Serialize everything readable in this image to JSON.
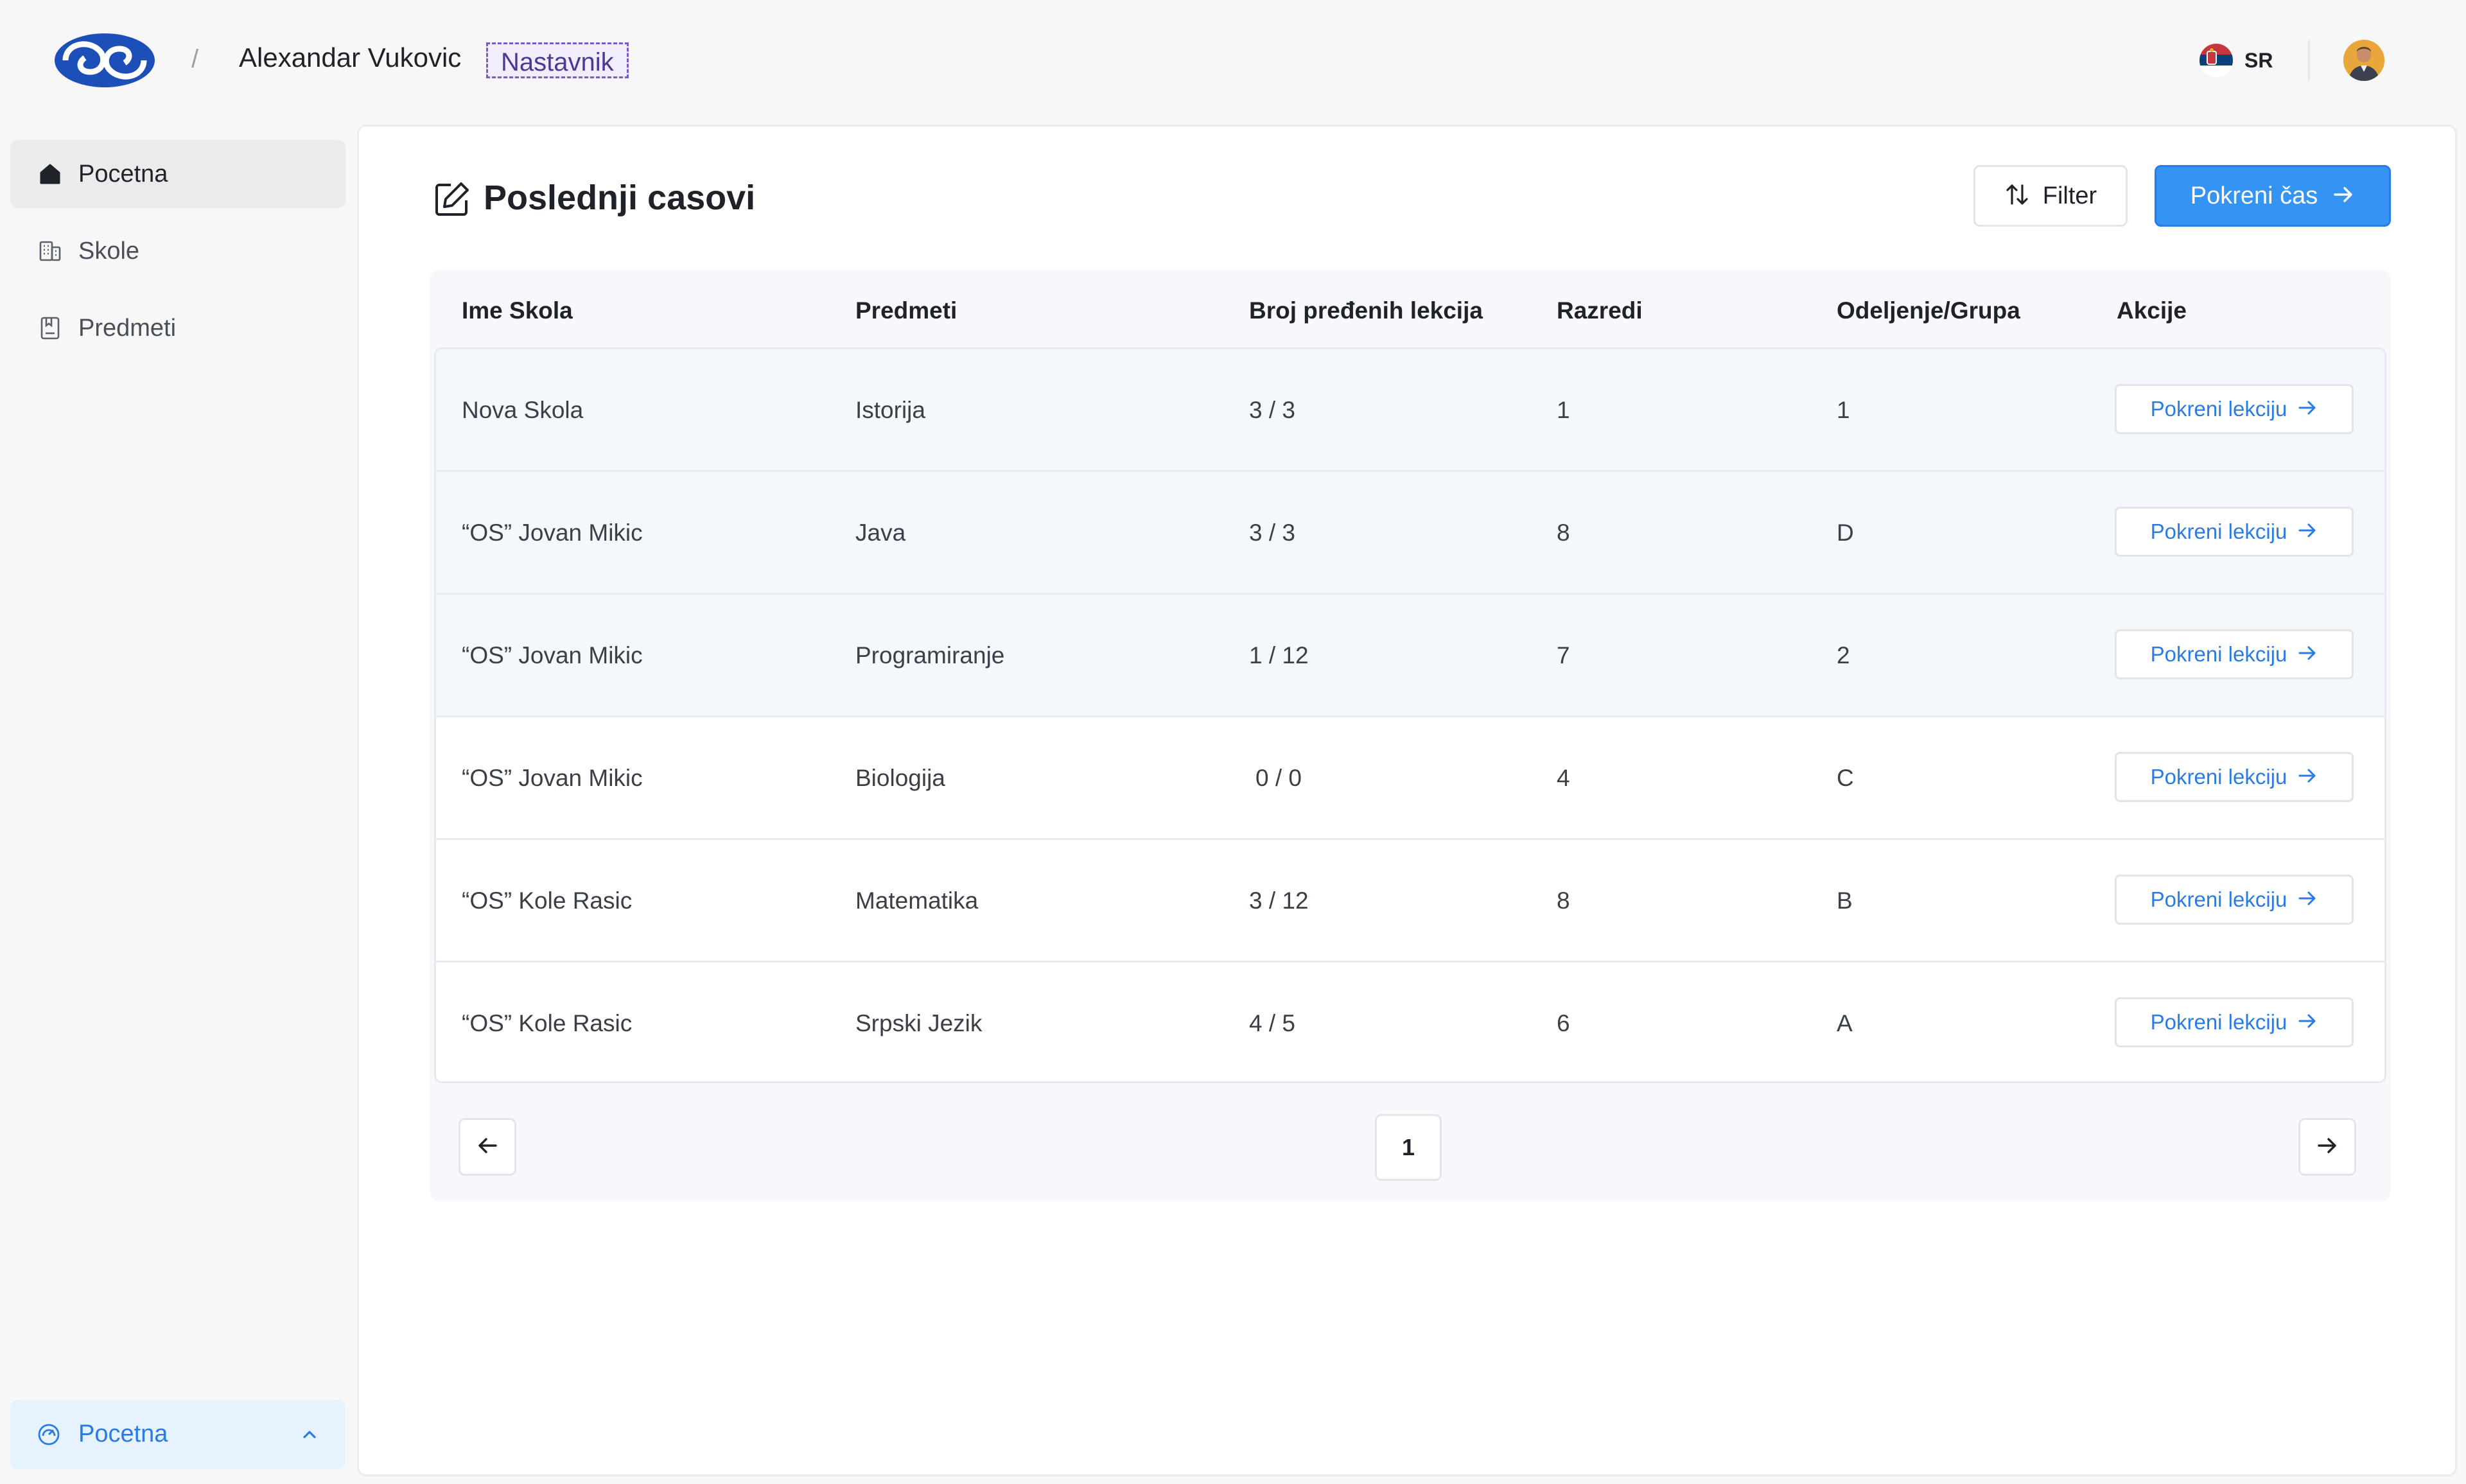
{
  "header": {
    "logo_icon": "app-logo",
    "breadcrumb_separator": "/",
    "user_name": "Alexandar Vukovic",
    "role": "Nastavnik",
    "language": {
      "flag_icon": "serbia-flag-icon",
      "label": "SR"
    },
    "avatar_icon": "user-avatar"
  },
  "sidebar": {
    "items": [
      {
        "label": "Pocetna",
        "icon": "home-icon",
        "active": true
      },
      {
        "label": "Skole",
        "icon": "building-icon",
        "active": false
      },
      {
        "label": "Predmeti",
        "icon": "book-icon",
        "active": false
      }
    ],
    "bottom": {
      "label": "Pocetna",
      "icon": "dashboard-icon",
      "chevron": "chevron-up-icon"
    }
  },
  "main": {
    "title": "Poslednji casovi",
    "title_icon": "edit-icon",
    "filter_label": "Filter",
    "primary_label": "Pokreni čas",
    "table": {
      "headers": [
        "Ime Skola",
        "Predmeti",
        "Broj pređenih lekcija",
        "Razredi",
        "Odeljenje/Grupa",
        "Akcije"
      ],
      "rows": [
        {
          "school": "Nova Skola",
          "subject": "Istorija",
          "lessons": "3 / 3",
          "grade": "1",
          "group": "1",
          "action": "Pokreni lekciju"
        },
        {
          "school": "“OS” Jovan Mikic",
          "subject": "Java",
          "lessons": "3 / 3",
          "grade": "8",
          "group": "D",
          "action": "Pokreni lekciju"
        },
        {
          "school": "“OS” Jovan Mikic",
          "subject": "Programiranje",
          "lessons": "1 / 12",
          "grade": "7",
          "group": "2",
          "action": "Pokreni lekciju"
        },
        {
          "school": "“OS” Jovan Mikic",
          "subject": "Biologija",
          "lessons": "0 / 0",
          "grade": "4",
          "group": "C",
          "action": "Pokreni lekciju"
        },
        {
          "school": "“OS” Kole Rasic",
          "subject": "Matematika",
          "lessons": "3 / 12",
          "grade": "8",
          "group": "B",
          "action": "Pokreni lekciju"
        },
        {
          "school": "“OS” Kole Rasic",
          "subject": "Srpski Jezik",
          "lessons": "4 / 5",
          "grade": "6",
          "group": "A",
          "action": "Pokreni lekciju"
        }
      ]
    },
    "pagination": {
      "current_page": "1"
    }
  },
  "colors": {
    "accent": "#3593f4",
    "accent_text": "#2a7be3",
    "role_badge": "#f2ecff",
    "row_tint": "#f4f8fd"
  }
}
